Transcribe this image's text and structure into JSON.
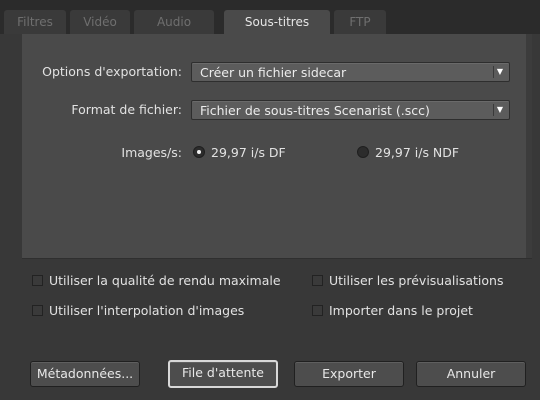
{
  "tabs": [
    {
      "label": "Filtres",
      "active": false
    },
    {
      "label": "Vidéo",
      "active": false
    },
    {
      "label": "Audio",
      "active": false
    },
    {
      "label": "Sous-titres",
      "active": true
    },
    {
      "label": "FTP",
      "active": false
    }
  ],
  "export_options": {
    "label": "Options d'exportation:",
    "value": "Créer un fichier sidecar"
  },
  "file_format": {
    "label": "Format de fichier:",
    "value": "Fichier de sous-titres Scenarist (.scc)"
  },
  "frame_rate": {
    "label": "Images/s:",
    "options": [
      {
        "label": "29,97 i/s DF",
        "checked": true
      },
      {
        "label": "29,97 i/s NDF",
        "checked": false
      }
    ]
  },
  "checkboxes": {
    "max_render_quality": {
      "label": "Utiliser la qualité de rendu maximale",
      "checked": false
    },
    "use_previews": {
      "label": "Utiliser les prévisualisations",
      "checked": false
    },
    "frame_blending": {
      "label": "Utiliser l'interpolation d'images",
      "checked": false
    },
    "import_into_project": {
      "label": "Importer dans le projet",
      "checked": false
    }
  },
  "buttons": {
    "metadata": "Métadonnées...",
    "queue": "File d'attente",
    "export": "Exporter",
    "cancel": "Annuler"
  },
  "colors": {
    "tab_bar": "#2b2b2b",
    "panel": "#4a4a4a",
    "background": "#383838"
  }
}
